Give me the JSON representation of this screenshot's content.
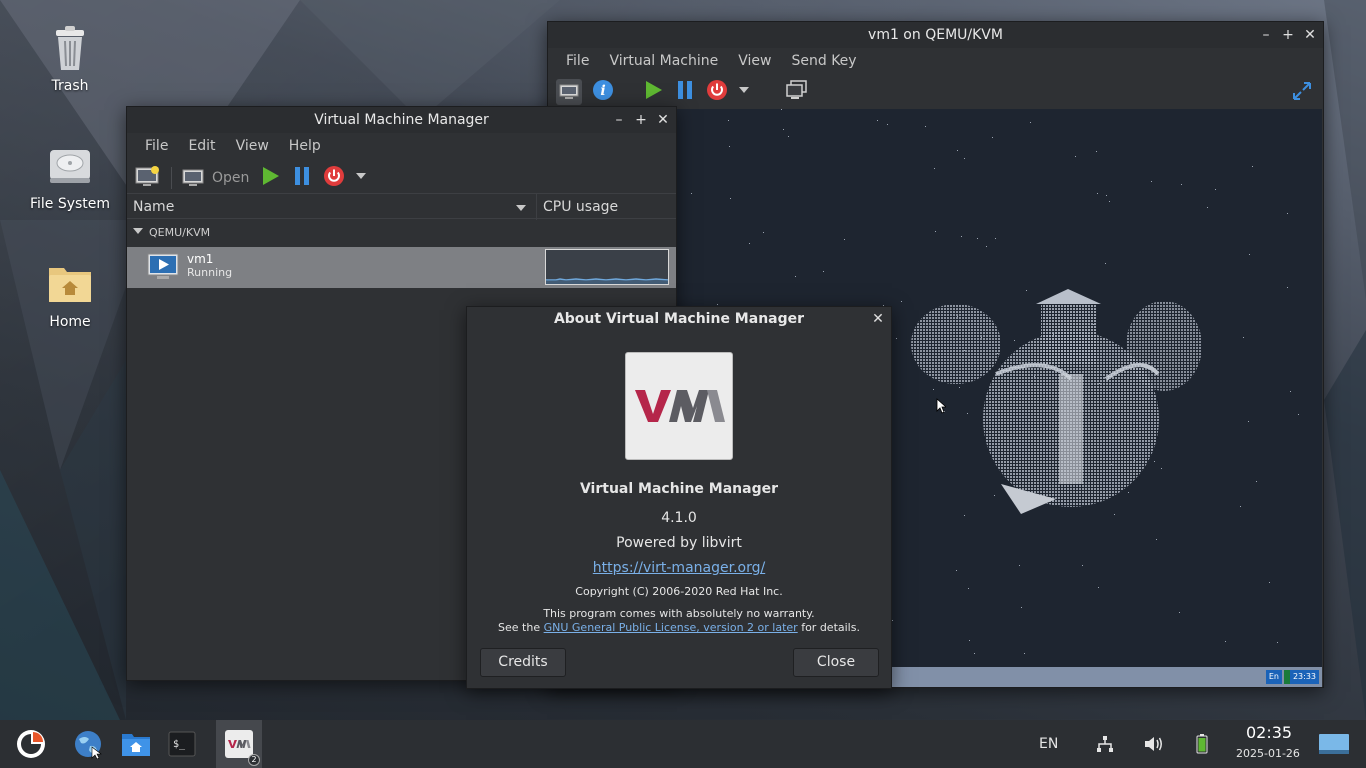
{
  "desktop": {
    "icons": [
      {
        "label": "Trash",
        "icon": "trash-icon"
      },
      {
        "label": "File System",
        "icon": "drive-icon"
      },
      {
        "label": "Home",
        "icon": "home-folder-icon"
      }
    ]
  },
  "vm_window": {
    "title": "vm1 on QEMU/KVM",
    "menu": [
      "File",
      "Virtual Machine",
      "View",
      "Send Key"
    ],
    "guest_tray": {
      "lang": "En",
      "clock": "23:33"
    }
  },
  "manager_window": {
    "title": "Virtual Machine Manager",
    "menu": [
      "File",
      "Edit",
      "View",
      "Help"
    ],
    "toolbar": {
      "open_label": "Open"
    },
    "columns": {
      "name": "Name",
      "cpu": "CPU usage"
    },
    "group": "QEMU/KVM",
    "vm": {
      "name": "vm1",
      "status": "Running"
    }
  },
  "about_dialog": {
    "title": "About Virtual Machine Manager",
    "app_name": "Virtual Machine Manager",
    "version": "4.1.0",
    "powered_by": "Powered by libvirt",
    "website": "https://virt-manager.org/",
    "copyright": "Copyright (C) 2006-2020 Red Hat Inc.",
    "warranty": "This program comes with absolutely no warranty.",
    "license_prefix": "See the",
    "license_link": "GNU General Public License, version 2 or later",
    "license_suffix": "for details.",
    "logo_text": "VM",
    "credits_button": "Credits",
    "close_button": "Close"
  },
  "taskbar": {
    "badge_count": "2",
    "keyboard_layout": "EN",
    "time": "02:35",
    "date": "2025-01-26"
  },
  "colors": {
    "accent_green": "#5fb832",
    "accent_blue": "#3d8fe0",
    "accent_red": "#e03c3c",
    "link": "#7ab0e8"
  }
}
